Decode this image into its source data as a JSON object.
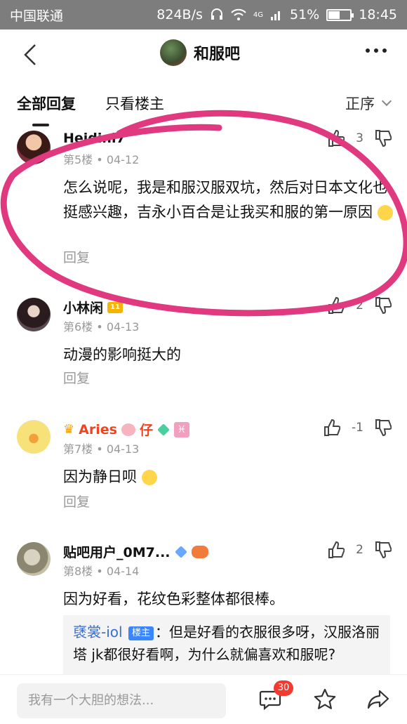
{
  "status_bar": {
    "carrier": "中国联通",
    "net_speed": "824B/s",
    "signal_tag": "4G",
    "battery": "51%",
    "battery_level": 0.51,
    "time": "18:45"
  },
  "nav": {
    "back_icon": "back-arrow-icon",
    "title": "和服吧",
    "more_icon": "more-dots-icon"
  },
  "tabs": {
    "all": "全部回复",
    "owner_only": "只看楼主",
    "sort": "正序"
  },
  "posts": [
    {
      "username": "Heidini7",
      "floor": "第5楼",
      "date": "04-12",
      "likes": "3",
      "content": "怎么说呢，我是和服汉服双坑，然后对日本文化也挺感兴趣，吉永小百合是让我买和服的第一原因",
      "reply": "回复"
    },
    {
      "username": "小林闲",
      "level": "11",
      "floor": "第6楼",
      "date": "04-13",
      "likes": "2",
      "content": "动漫的影响挺大的",
      "reply": "回复"
    },
    {
      "username": "Aries",
      "name_suffix": "仔",
      "floor": "第7楼",
      "date": "04-13",
      "likes": "-1",
      "content": "因为静日呗",
      "reply": "回复"
    },
    {
      "username": "贴吧用户_0M7...",
      "floor": "第8楼",
      "date": "04-14",
      "likes": "2",
      "content": "因为好看，花纹色彩整体都很棒。",
      "quote": {
        "name": "褎裳-iol",
        "tag": "楼主",
        "text": "：但是好看的衣服很多呀，汉服洛丽塔 jk都很好看啊，为什么就偏喜欢和服呢?"
      }
    }
  ],
  "separator": "•",
  "bottom": {
    "input_placeholder": "我有一个大胆的想法...",
    "comment_count": "30"
  },
  "colors": {
    "accent_link": "#3a6ecf",
    "badge_red": "#f23a2f",
    "annotation_pink": "#e0397f"
  }
}
